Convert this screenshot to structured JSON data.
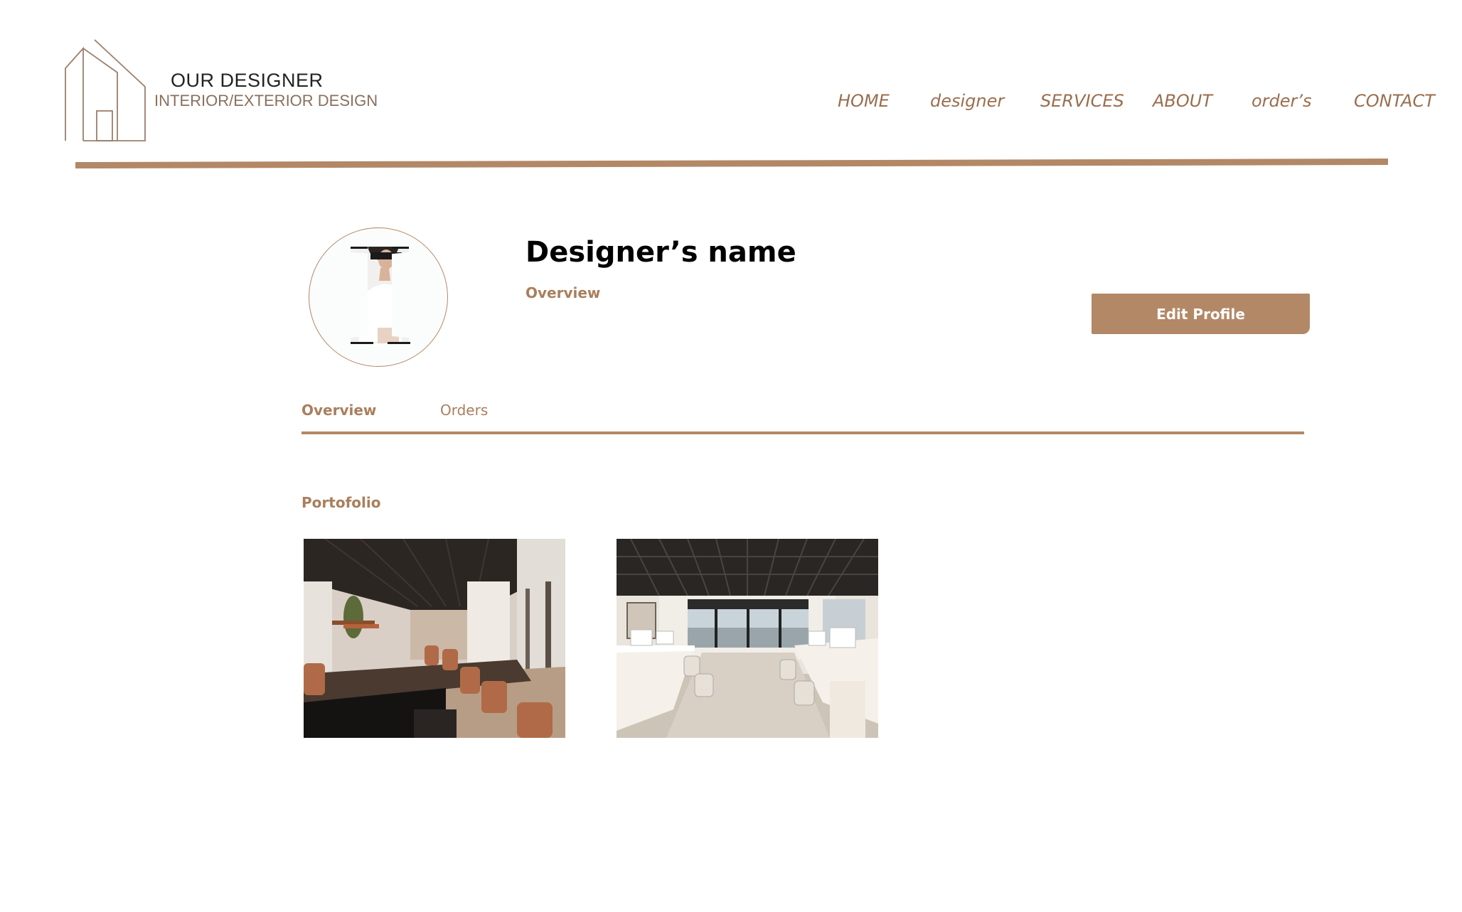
{
  "brand": {
    "line1": "OUR DESIGNER",
    "line2": "INTERIOR/EXTERIOR DESIGN",
    "logo_icon": "house-outline-icon"
  },
  "nav": {
    "items": [
      {
        "label": "HOME"
      },
      {
        "label": "designer"
      },
      {
        "label": "SERVICES"
      },
      {
        "label": "ABOUT"
      },
      {
        "label": "order’s"
      },
      {
        "label": "CONTACT"
      }
    ]
  },
  "profile": {
    "name": "Designer’s name",
    "subtitle": "Overview",
    "edit_label": "Edit Profile"
  },
  "tabs": [
    {
      "label": "Overview",
      "active": true
    },
    {
      "label": "Orders",
      "active": false
    }
  ],
  "portfolio": {
    "title": "Portofolio"
  },
  "colors": {
    "accent": "#b38866",
    "accent_text": "#a97f5d"
  }
}
